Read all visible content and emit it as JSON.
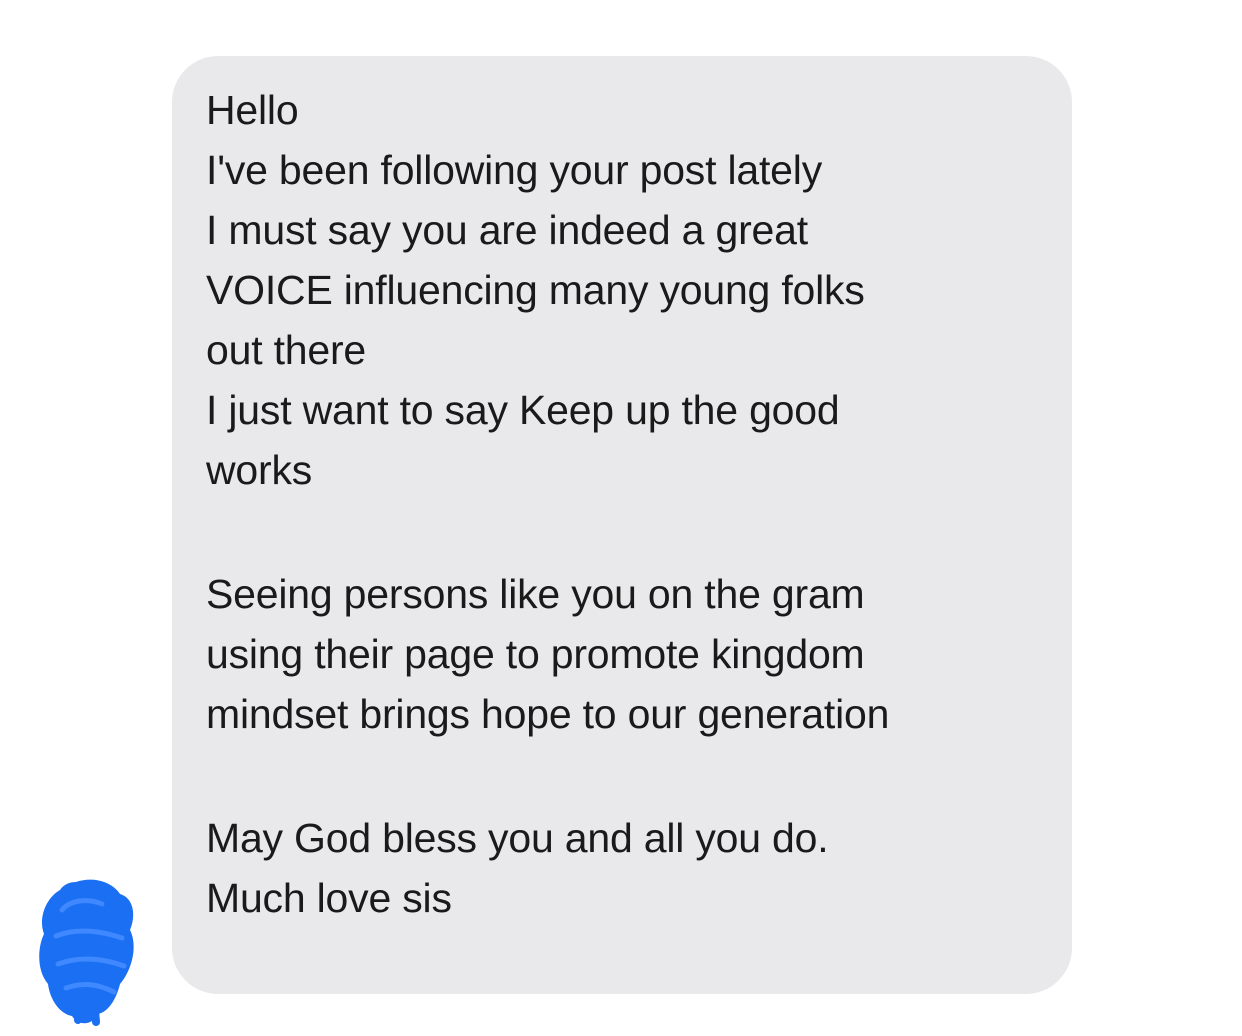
{
  "message": {
    "lines": [
      "Hello",
      "I've been following your post lately",
      "I must say you are indeed a great",
      "VOICE influencing many young folks",
      "out there",
      "I just want to say Keep up the good",
      "works",
      "Seeing persons like you on the gram",
      "using their page to promote kingdom",
      "mindset brings hope to our generation",
      "May God bless you and all you do.",
      "Much love sis"
    ]
  },
  "avatar": {
    "icon": "redacted-avatar-icon",
    "color": "#1a6ff2"
  },
  "colors": {
    "bubble": "#e9e9eb",
    "text": "#1a1a1a",
    "background": "#ffffff"
  }
}
